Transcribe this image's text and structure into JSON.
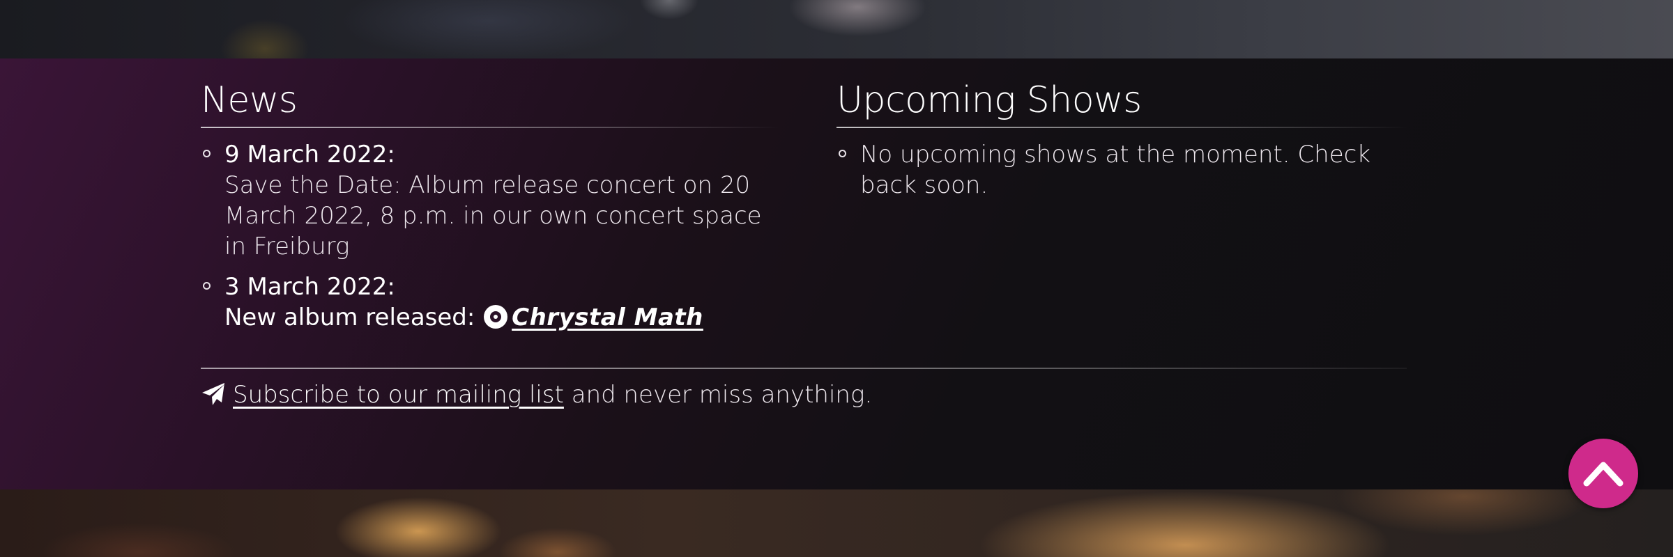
{
  "news": {
    "title": "News",
    "items": [
      {
        "date": "9 March 2022:",
        "text": "Save the Date: Album release concert on 20 March 2022, 8 p.m. in our own concert space in Freiburg"
      },
      {
        "date": "3 March 2022:",
        "prefix": "New album released:",
        "link_text": "Chrystal Math",
        "icon": "record-disc-icon"
      }
    ]
  },
  "shows": {
    "title": "Upcoming Shows",
    "items": [
      {
        "text": "No upcoming shows at the moment. Check back soon."
      }
    ]
  },
  "subscribe": {
    "icon": "paper-plane-icon",
    "link_text": "Subscribe to our mailing list",
    "suffix": " and never miss anything."
  },
  "scroll_top": {
    "icon": "chevron-up-icon",
    "color": "#cf2a8b"
  },
  "colors": {
    "band_start": "#3a1537",
    "band_end": "#0f0e11",
    "accent": "#cf2a8b"
  }
}
